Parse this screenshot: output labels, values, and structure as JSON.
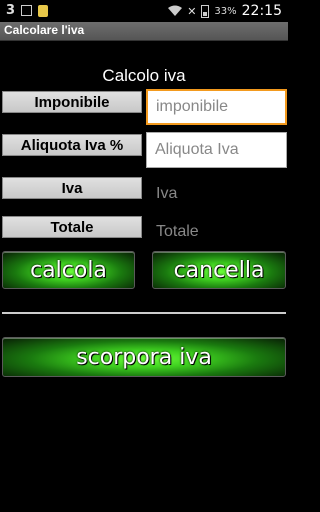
{
  "status_bar": {
    "carrier_number": "3",
    "battery_percent": "33%",
    "time": "22:15"
  },
  "app": {
    "title": "Calcolare l'iva"
  },
  "form": {
    "heading": "Calcolo iva",
    "imponibile": {
      "label": "Imponibile",
      "placeholder": "imponibile",
      "value": ""
    },
    "aliquota": {
      "label": "Aliquota Iva %",
      "placeholder": "Aliquota Iva",
      "value": ""
    },
    "iva": {
      "label": "Iva",
      "value": "Iva"
    },
    "totale": {
      "label": "Totale",
      "value": "Totale"
    }
  },
  "buttons": {
    "calcola": "calcola",
    "cancella": "cancella",
    "scorpora": "scorpora iva"
  },
  "colors": {
    "accent_focus": "#f39a1e",
    "button_green": "#3fd020"
  }
}
